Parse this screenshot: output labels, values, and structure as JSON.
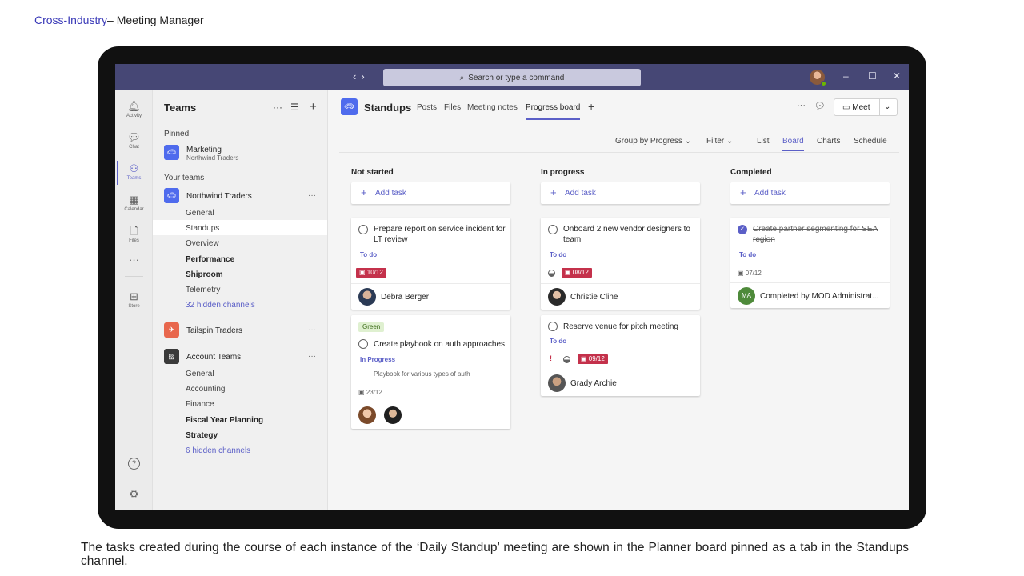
{
  "slide": {
    "header_accent": "Cross-Industry",
    "header_rest": "– Meeting Manager",
    "caption": "The tasks created during the course of each instance of the ‘Daily Standup’ meeting are shown in the Planner board pinned as a tab in the Standups channel."
  },
  "titlebar": {
    "search_placeholder": "Search or type a command"
  },
  "rail": {
    "items": [
      {
        "label": "Activity",
        "icon": "bell-icon"
      },
      {
        "label": "Chat",
        "icon": "chat-icon"
      },
      {
        "label": "Teams",
        "icon": "teams-icon"
      },
      {
        "label": "Calendar",
        "icon": "calendar-icon"
      },
      {
        "label": "Files",
        "icon": "file-icon"
      },
      {
        "label": "Store",
        "icon": "apps-icon"
      }
    ],
    "active": "Teams",
    "help_glyph": "?",
    "settings_glyph": "⚙"
  },
  "teams_panel": {
    "title": "Teams",
    "pinned_heading": "Pinned",
    "pinned_team": {
      "name": "Marketing",
      "subtitle": "Northwind Traders"
    },
    "your_teams_heading": "Your teams",
    "teams": [
      {
        "name": "Northwind Traders",
        "channels": [
          {
            "name": "General",
            "style": "normal"
          },
          {
            "name": "Standups",
            "style": "active"
          },
          {
            "name": "Overview",
            "style": "normal"
          },
          {
            "name": "Performance",
            "style": "bold"
          },
          {
            "name": "Shiproom",
            "style": "bold"
          },
          {
            "name": "Telemetry",
            "style": "normal"
          },
          {
            "name": "32 hidden channels",
            "style": "link"
          }
        ]
      },
      {
        "name": "Tailspin Traders",
        "channels": []
      },
      {
        "name": "Account Teams",
        "channels": [
          {
            "name": "General",
            "style": "normal"
          },
          {
            "name": "Accounting",
            "style": "normal"
          },
          {
            "name": "Finance",
            "style": "normal"
          },
          {
            "name": "Fiscal Year Planning",
            "style": "bold"
          },
          {
            "name": "Strategy",
            "style": "bold"
          },
          {
            "name": "6 hidden channels",
            "style": "link"
          }
        ]
      }
    ]
  },
  "channel_header": {
    "name": "Standups",
    "tabs": [
      "Posts",
      "Files",
      "Meeting notes",
      "Progress board"
    ],
    "active_tab": "Progress board",
    "add_tab_glyph": "+",
    "meet_label": "Meet"
  },
  "board_toolbar": {
    "group_by": "Group by Progress",
    "filter": "Filter",
    "views": [
      "List",
      "Board",
      "Charts",
      "Schedule"
    ],
    "active_view": "Board"
  },
  "board": {
    "add_task_label": "Add task",
    "buckets": [
      {
        "title": "Not started",
        "cards": [
          {
            "title": "Prepare report on service incident for LT review",
            "bucket": "To do",
            "due": "10/12",
            "assignee": "Debra Berger"
          },
          {
            "label": "Green",
            "title": "Create playbook on auth approaches",
            "bucket": "In Progress",
            "description": "Playbook for various types of auth",
            "due": "23/12"
          }
        ]
      },
      {
        "title": "In progress",
        "cards": [
          {
            "title": "Onboard 2 new vendor designers to team",
            "bucket": "To do",
            "due": "08/12",
            "assignee": "Christie Cline"
          },
          {
            "title": "Reserve venue for pitch meeting",
            "bucket": "To do",
            "urgent": "!",
            "due": "09/12",
            "assignee": "Grady Archie"
          }
        ]
      },
      {
        "title": "Completed",
        "cards": [
          {
            "title": "Create partner segmenting for SEA region",
            "bucket": "To do",
            "due": "07/12",
            "assignee_initials": "MA",
            "assignee": "Completed by MOD Administrat..."
          }
        ]
      }
    ]
  },
  "colors": {
    "titlebar": "#464775",
    "accent": "#5b5fc7",
    "overdue": "#c4314b"
  }
}
